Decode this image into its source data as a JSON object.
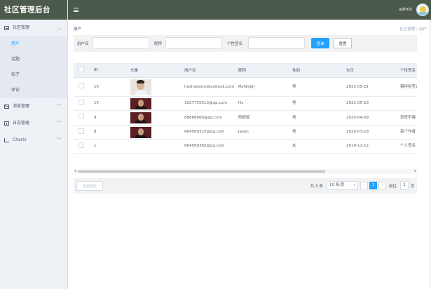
{
  "app": {
    "title": "社区管理后台",
    "admin_name": "admin"
  },
  "sidebar": {
    "groups": [
      {
        "label": "社区管理",
        "icon": "document-icon",
        "expanded": true,
        "items": [
          {
            "label": "用户",
            "active": true
          },
          {
            "label": "话题",
            "active": false
          },
          {
            "label": "帖子",
            "active": false
          },
          {
            "label": "评论",
            "active": false
          }
        ]
      },
      {
        "label": "消息管理",
        "icon": "mail-icon",
        "expanded": false,
        "items": []
      },
      {
        "label": "日志管理",
        "icon": "calendar-icon",
        "expanded": false,
        "items": []
      },
      {
        "label": "Charts",
        "icon": "chart-icon",
        "expanded": false,
        "items": []
      }
    ]
  },
  "breadcrumb": {
    "current": "用户",
    "path": [
      "社区管理",
      "用户"
    ]
  },
  "filters": {
    "username_label": "用户名",
    "username_value": "",
    "nickname_label": "昵称",
    "nickname_value": "",
    "signature_label": "个性签名",
    "signature_value": "",
    "search_button": "查询",
    "reset_button": "重置"
  },
  "table": {
    "columns": [
      "ID",
      "头像",
      "用户名",
      "昵称",
      "性别",
      "生日",
      "个性签名"
    ],
    "rows": [
      {
        "id": "16",
        "avatar": "light",
        "username": "hexhedonic@outlook.com",
        "nickname": "MyNickJJ",
        "gender": "男",
        "birthday": "2022-05-21",
        "signature": "需特别签名"
      },
      {
        "id": "15",
        "avatar": "dark",
        "username": "1027755513@qq.com",
        "nickname": "Hx",
        "gender": "男",
        "birthday": "2022-05-18",
        "signature": ""
      },
      {
        "id": "9",
        "avatar": "dark",
        "username": "88886666@qq.com",
        "nickname": "阿妮妮",
        "gender": "男",
        "birthday": "2020-04-09",
        "signature": "哀思不懂"
      },
      {
        "id": "8",
        "avatar": "dark",
        "username": "664560322@qq.com",
        "nickname": "Jason",
        "gender": "男",
        "birthday": "2020-03-18",
        "signature": "每个作者"
      },
      {
        "id": "1",
        "avatar": "none",
        "username": "664560383@qq.com",
        "nickname": "",
        "gender": "女",
        "birthday": "2019-11-12",
        "signature": "个人签名"
      }
    ]
  },
  "footer": {
    "batch_delete": "批量删除",
    "total": "共 5 条",
    "page_size": "10 条/页",
    "current_page": "1",
    "goto_label": "前往",
    "goto_value": "1",
    "goto_suffix": "页"
  },
  "colors": {
    "header_bg": "#4b5a4b",
    "accent": "#20a0ff",
    "sidebar_bg": "#eef1f6"
  }
}
